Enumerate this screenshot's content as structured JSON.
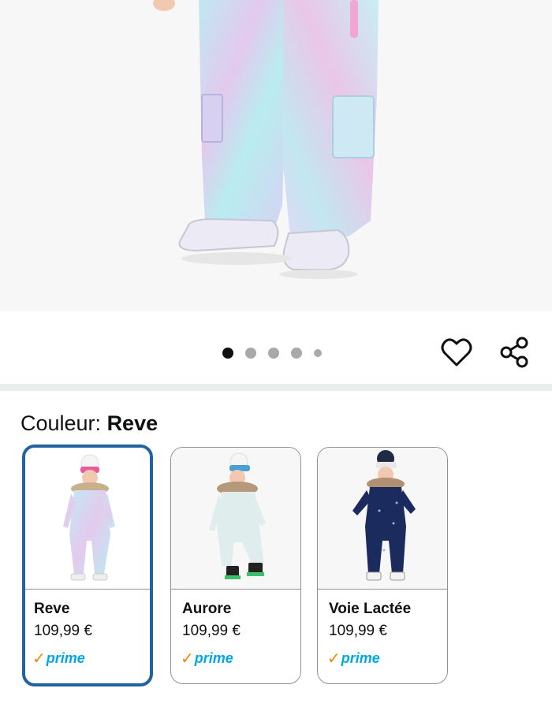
{
  "colors": {
    "accent_selected": "#2162a1",
    "prime_check": "#f08804",
    "prime_word": "#00a8e1",
    "dot_active": "#0f1111",
    "dot_inactive": "#a9a9a9"
  },
  "gallery": {
    "image_count": 5,
    "active_index": 0,
    "icons": [
      "heart-icon",
      "share-icon"
    ]
  },
  "variation": {
    "label": "Couleur: ",
    "selected_value": "Reve",
    "options": [
      {
        "name": "Reve",
        "price": "109,99 €",
        "prime_check": "✓",
        "prime_word": "prime",
        "selected": true
      },
      {
        "name": "Aurore",
        "price": "109,99 €",
        "prime_check": "✓",
        "prime_word": "prime",
        "selected": false
      },
      {
        "name": "Voie Lactée",
        "price": "109,99 €",
        "prime_check": "✓",
        "prime_word": "prime",
        "selected": false
      }
    ]
  }
}
